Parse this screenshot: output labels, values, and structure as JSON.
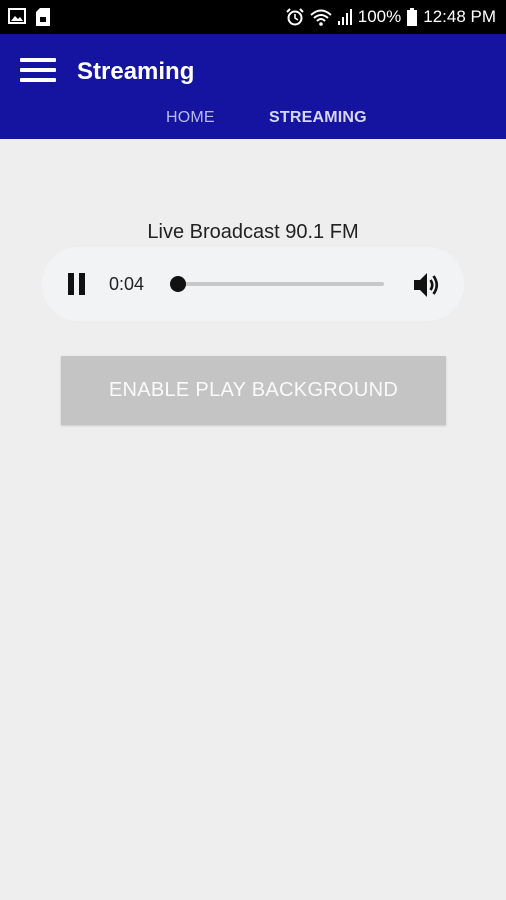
{
  "status_bar": {
    "battery_percent": "100%",
    "time": "12:48 PM",
    "icons": [
      "image-icon",
      "sd-card-icon",
      "alarm-icon",
      "wifi-icon",
      "signal-icon",
      "battery-icon"
    ]
  },
  "app_bar": {
    "title": "Streaming",
    "color": "#1414a0"
  },
  "tabs": [
    {
      "label": "HOME",
      "selected": false
    },
    {
      "label": "STREAMING",
      "selected": true
    }
  ],
  "player": {
    "title": "Live Broadcast 90.1 FM",
    "current_time": "0:04",
    "state": "playing",
    "progress": 0.0
  },
  "buttons": {
    "enable_background": "ENABLE PLAY BACKGROUND"
  }
}
